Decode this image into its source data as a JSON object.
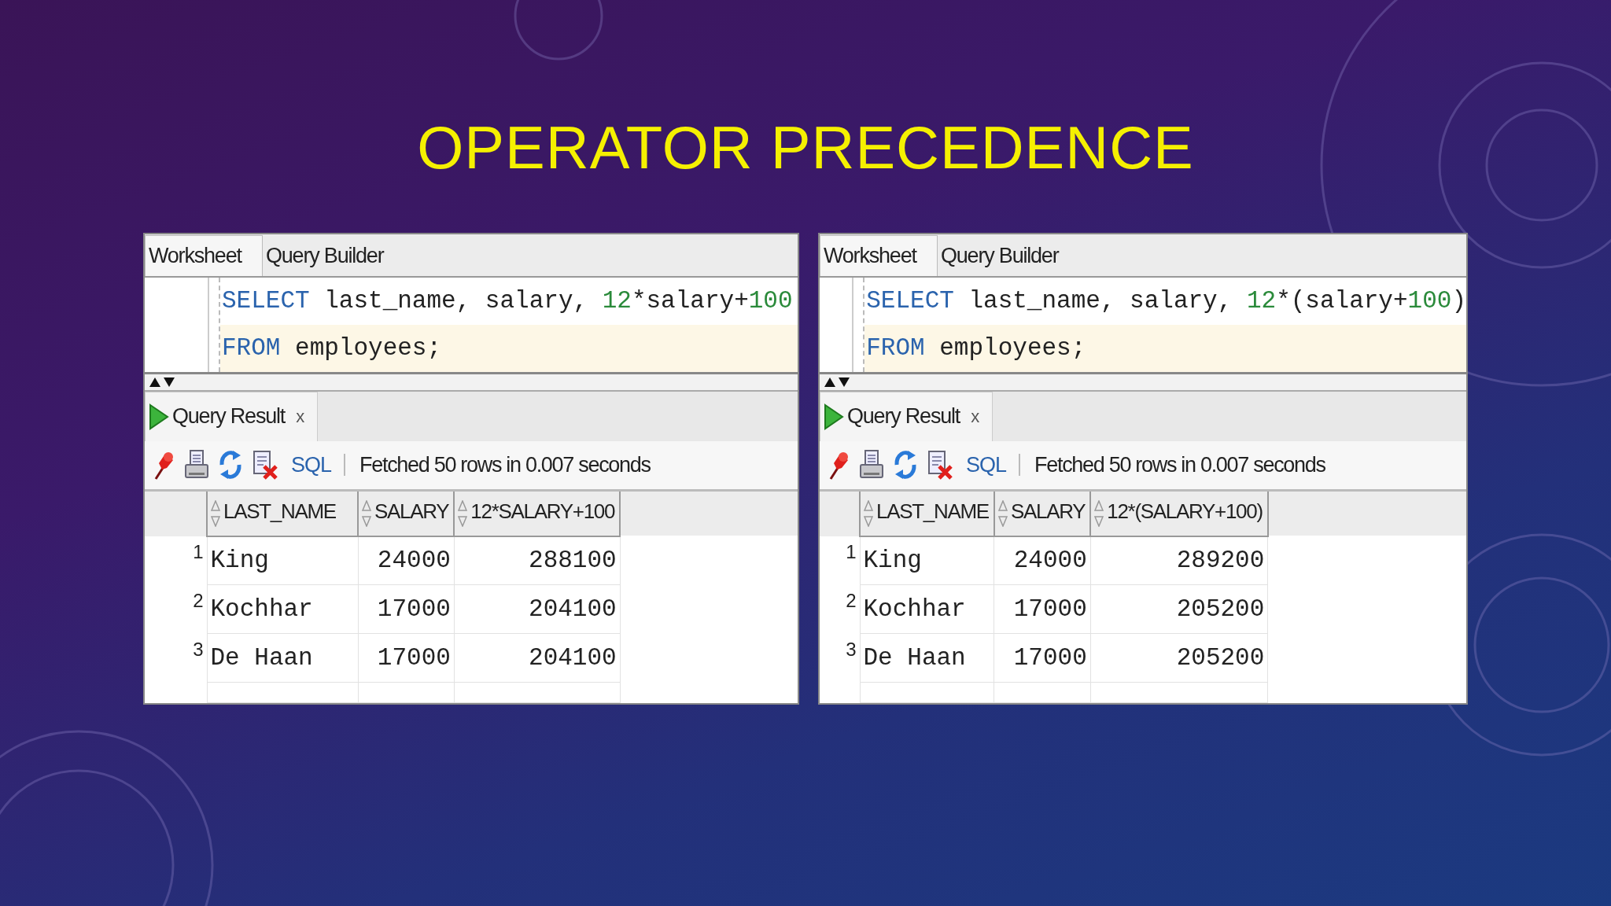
{
  "title": "OPERATOR PRECEDENCE",
  "panels": [
    {
      "tabs": [
        {
          "label": "Worksheet",
          "selected": true
        },
        {
          "label": "Query Builder",
          "selected": false
        }
      ],
      "code": [
        {
          "highlighted": false,
          "tokens": [
            {
              "text": "SELECT",
              "kind": "keyword"
            },
            {
              "text": " last_name, salary, ",
              "kind": "plain"
            },
            {
              "text": "12",
              "kind": "number"
            },
            {
              "text": "*salary+",
              "kind": "plain"
            },
            {
              "text": "100",
              "kind": "number"
            }
          ]
        },
        {
          "highlighted": true,
          "tokens": [
            {
              "text": "FROM",
              "kind": "keyword"
            },
            {
              "text": " employees;",
              "kind": "plain"
            }
          ]
        }
      ],
      "result_tab": {
        "label": "Query Result",
        "close": "x"
      },
      "toolbar": {
        "sql_label": "SQL",
        "status": "Fetched 50 rows in 0.007 seconds"
      },
      "table": {
        "columns": [
          "LAST_NAME",
          "SALARY",
          "12*SALARY+100"
        ],
        "rows": [
          {
            "number": "1",
            "cells": [
              "King",
              "24000",
              "288100"
            ]
          },
          {
            "number": "2",
            "cells": [
              "Kochhar",
              "17000",
              "204100"
            ]
          },
          {
            "number": "3",
            "cells": [
              "De Haan",
              "17000",
              "204100"
            ]
          }
        ]
      }
    },
    {
      "tabs": [
        {
          "label": "Worksheet",
          "selected": true
        },
        {
          "label": "Query Builder",
          "selected": false
        }
      ],
      "code": [
        {
          "highlighted": false,
          "tokens": [
            {
              "text": "SELECT",
              "kind": "keyword"
            },
            {
              "text": " last_name, salary, ",
              "kind": "plain"
            },
            {
              "text": "12",
              "kind": "number"
            },
            {
              "text": "*(salary+",
              "kind": "plain"
            },
            {
              "text": "100",
              "kind": "number"
            },
            {
              "text": ")",
              "kind": "plain"
            }
          ]
        },
        {
          "highlighted": true,
          "tokens": [
            {
              "text": "FROM",
              "kind": "keyword"
            },
            {
              "text": " employees;",
              "kind": "plain"
            }
          ]
        }
      ],
      "result_tab": {
        "label": "Query Result",
        "close": "x"
      },
      "toolbar": {
        "sql_label": "SQL",
        "status": "Fetched 50 rows in 0.007 seconds"
      },
      "table": {
        "columns": [
          "LAST_NAME",
          "SALARY",
          "12*(SALARY+100)"
        ],
        "rows": [
          {
            "number": "1",
            "cells": [
              "King",
              "24000",
              "289200"
            ]
          },
          {
            "number": "2",
            "cells": [
              "Kochhar",
              "17000",
              "205200"
            ]
          },
          {
            "number": "3",
            "cells": [
              "De Haan",
              "17000",
              "205200"
            ]
          }
        ]
      }
    }
  ]
}
